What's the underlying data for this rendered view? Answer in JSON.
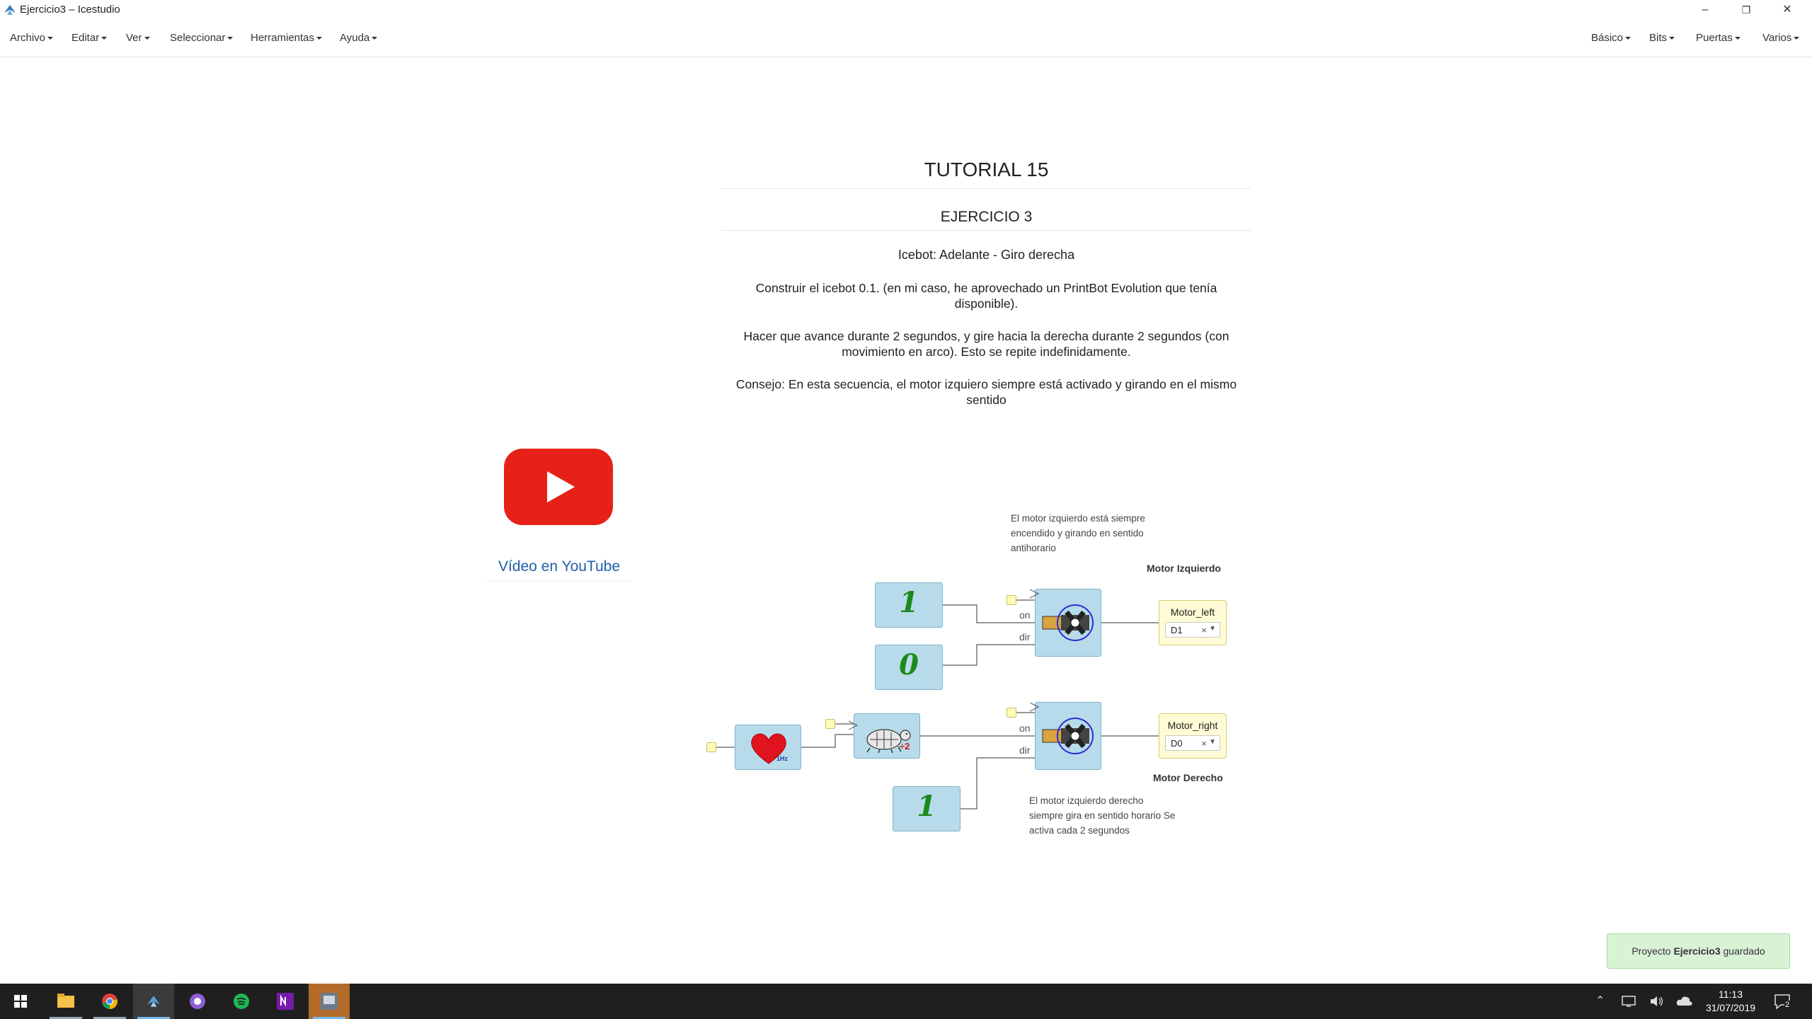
{
  "window": {
    "title": "Ejercicio3 – Icestudio",
    "controls": {
      "minimize": "–",
      "restore": "❐",
      "close": "✕"
    }
  },
  "menubar": {
    "left": [
      "Archivo",
      "Editar",
      "Ver",
      "Seleccionar",
      "Herramientas",
      "Ayuda"
    ],
    "right": [
      "Básico",
      "Bits",
      "Puertas",
      "Varios"
    ]
  },
  "info": {
    "title": "TUTORIAL 15",
    "subtitle": "EJERCICIO 3",
    "heading": "Icebot: Adelante - Giro derecha",
    "para1": "Construir el icebot 0.1. (en mi caso, he aprovechado un PrintBot Evolution que tenía disponible).",
    "para2": "Hacer que avance durante 2 segundos, y gire hacia la derecha durante 2 segundos (con movimiento en arco). Esto se repite indefinidamente.",
    "para3": "Consejo: En esta secuencia, el motor izquiero siempre está activado y girando en el mismo sentido"
  },
  "video": {
    "link_text": "Vídeo en YouTube",
    "icon": "youtube-play-icon",
    "color": "#e62117"
  },
  "circuit": {
    "note_left": "El motor izquierdo está siempre encendido y girando en sentido antihorario",
    "note_right": "El motor izquierdo derecho siempre gira en sentido horario Se activa cada 2 segundos",
    "label_motor_left": "Motor Izquierdo",
    "label_motor_right": "Motor Derecho",
    "const_one": "1",
    "const_zero": "0",
    "port_on": "on",
    "port_dir": "dir",
    "heart_freq": "1Hz",
    "prescaler": "÷2",
    "pins": [
      {
        "name": "Motor_left",
        "value": "D1"
      },
      {
        "name": "Motor_right",
        "value": "D0"
      }
    ],
    "clear_mark": "×"
  },
  "toast": {
    "prefix": "Proyecto ",
    "project": "Ejercicio3",
    "suffix": " guardado"
  },
  "taskbar": {
    "apps": [
      "start-icon",
      "file-explorer-icon",
      "chrome-icon",
      "icestudio-icon",
      "github-icon",
      "spotify-icon",
      "onenote-icon",
      "app-icon"
    ],
    "time": "11:13",
    "date": "31/07/2019",
    "notifications": "2"
  },
  "colors": {
    "block": "#b7dbea",
    "pin": "#fffbd6",
    "toast": "#d9f2d6",
    "taskbar": "#1f1f1f"
  }
}
